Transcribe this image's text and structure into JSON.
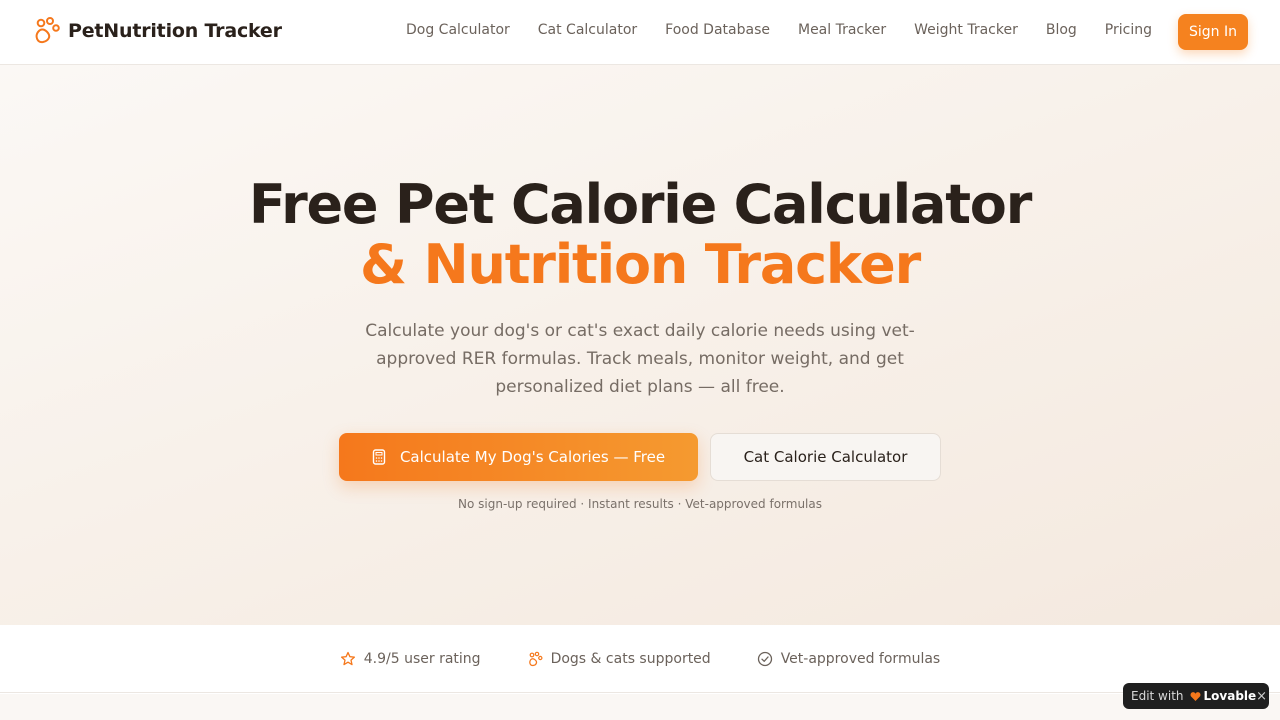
{
  "header": {
    "brand": "PetNutrition Tracker",
    "nav": [
      "Dog Calculator",
      "Cat Calculator",
      "Food Database",
      "Meal Tracker",
      "Weight Tracker",
      "Blog",
      "Pricing"
    ],
    "sign_in": "Sign In"
  },
  "hero": {
    "title_line1": "Free Pet Calorie Calculator",
    "title_line2": "& Nutrition Tracker",
    "subtitle": "Calculate your dog's or cat's exact daily calorie needs using vet-approved RER formulas. Track meals, monitor weight, and get personalized diet plans — all free.",
    "primary_cta": "Calculate My Dog's Calories — Free",
    "secondary_cta": "Cat Calorie Calculator",
    "note": "No sign-up required · Instant results · Vet-approved formulas"
  },
  "trust": {
    "items": [
      "4.9/5 user rating",
      "Dogs & cats supported",
      "Vet-approved formulas"
    ]
  },
  "badge": {
    "edit_with": "Edit with",
    "brand": "Lovable",
    "close": "×"
  },
  "colors": {
    "accent": "#f5781c",
    "text": "#2a211b",
    "muted": "#766c64"
  },
  "icons": {
    "brand": "paw-icon",
    "primary_cta": "calculator-icon",
    "trust": [
      "star-icon",
      "paw-icon",
      "check-circle-icon"
    ],
    "badge": "heart-icon"
  }
}
